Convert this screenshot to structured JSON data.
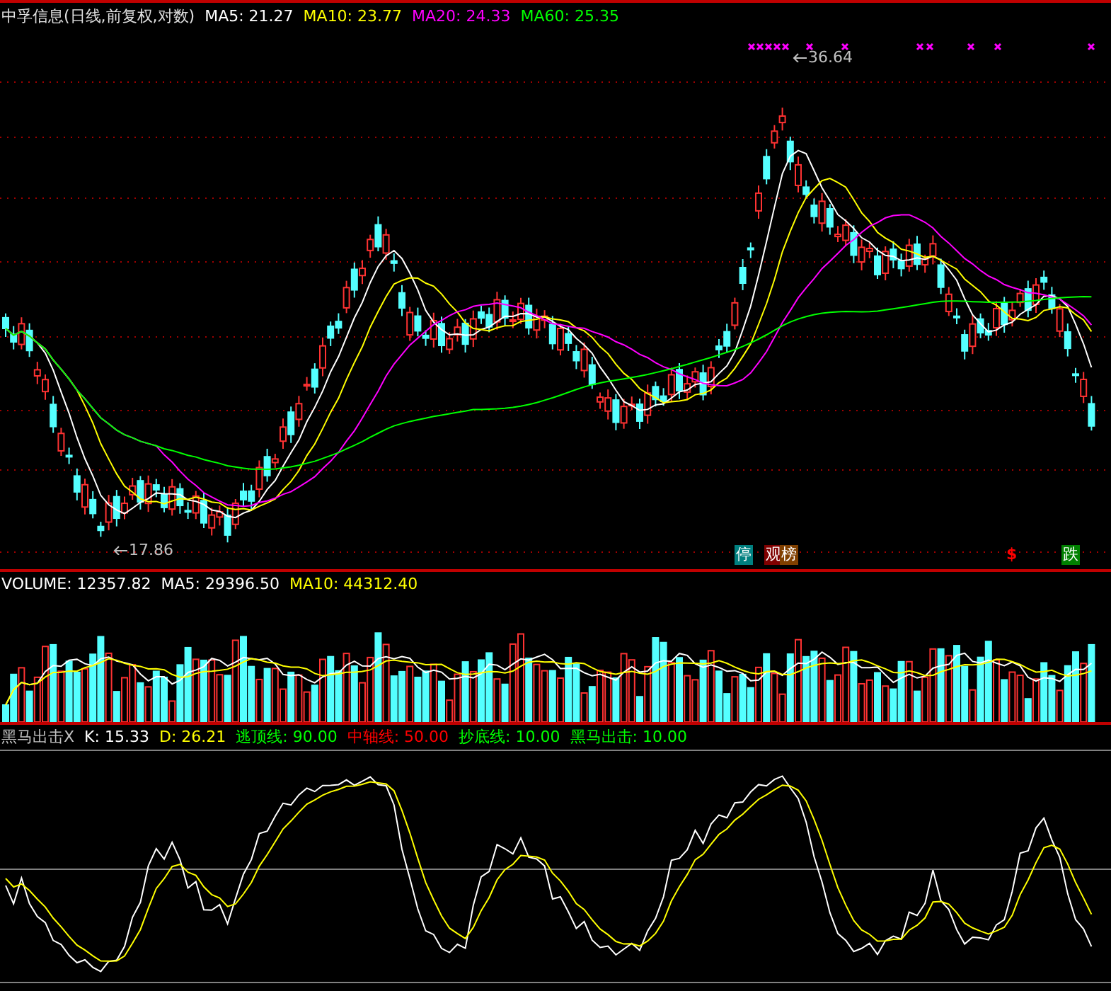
{
  "price_panel": {
    "title": "中孚信息(日线,前复权,对数)",
    "legend": [
      {
        "text": "MA5: 21.27",
        "color": "#ffffff"
      },
      {
        "text": "MA10: 23.77",
        "color": "#ffff00"
      },
      {
        "text": "MA20: 24.33",
        "color": "#ff00ff"
      },
      {
        "text": "MA60: 25.35",
        "color": "#00ff00"
      }
    ],
    "high_label": "36.64",
    "low_label": "17.86",
    "badges": [
      {
        "text": "停",
        "kind": "tile",
        "color": "#008080"
      },
      {
        "text": "观",
        "kind": "tile",
        "color": "#800000"
      },
      {
        "text": "榜",
        "kind": "tile",
        "color": "#804000"
      },
      {
        "text": "$",
        "kind": "glyph",
        "color": "#ff0000"
      },
      {
        "text": "跌",
        "kind": "tile",
        "color": "#008000"
      }
    ]
  },
  "volume_panel": {
    "legend": [
      {
        "text": "VOLUME: 12357.82",
        "color": "#ffffff"
      },
      {
        "text": "MA5: 29396.50",
        "color": "#ffffff"
      },
      {
        "text": "MA10: 44312.40",
        "color": "#ffff00"
      }
    ]
  },
  "indicator_panel": {
    "legend": [
      {
        "text": "黑马出击X",
        "color": "#c0c0c0"
      },
      {
        "text": "K: 15.33",
        "color": "#ffffff"
      },
      {
        "text": "D: 26.21",
        "color": "#ffff00"
      },
      {
        "text": "逃顶线: 90.00",
        "color": "#00ff00"
      },
      {
        "text": "中轴线: 50.00",
        "color": "#ff0000"
      },
      {
        "text": "抄底线: 10.00",
        "color": "#00ff00"
      },
      {
        "text": "黑马出击: 10.00",
        "color": "#00ff00"
      }
    ]
  }
}
